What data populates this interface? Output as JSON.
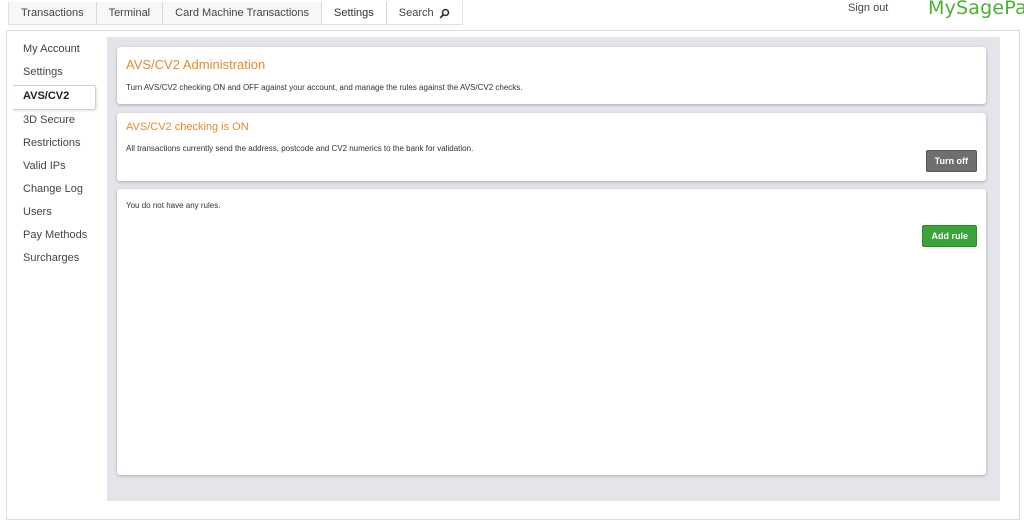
{
  "topnav": {
    "tabs": [
      {
        "label": "Transactions"
      },
      {
        "label": "Terminal"
      },
      {
        "label": "Card Machine Transactions"
      },
      {
        "label": "Settings",
        "active": true
      },
      {
        "label": "Search"
      }
    ]
  },
  "header": {
    "signout": "Sign out",
    "brand": "MySagePay"
  },
  "sidebar": {
    "items": [
      {
        "label": "My Account"
      },
      {
        "label": "Settings"
      },
      {
        "label": "AVS/CV2",
        "active": true
      },
      {
        "label": "3D Secure"
      },
      {
        "label": "Restrictions"
      },
      {
        "label": "Valid IPs"
      },
      {
        "label": "Change Log"
      },
      {
        "label": "Users"
      },
      {
        "label": "Pay Methods"
      },
      {
        "label": "Surcharges"
      }
    ]
  },
  "main": {
    "admin_panel": {
      "title": "AVS/CV2 Administration",
      "description": "Turn AVS/CV2 checking ON and OFF against your account, and manage the rules against the AVS/CV2 checks."
    },
    "status_panel": {
      "title": "AVS/CV2 checking is ON",
      "description": "All transactions currently send the address, postcode and CV2 numerics to the bank for validation.",
      "button": "Turn off"
    },
    "rules_panel": {
      "message": "You do not have any rules.",
      "button": "Add rule"
    }
  },
  "colors": {
    "accent_title": "#e58a2e",
    "brand": "#4bb133",
    "add_button": "#3aa33a",
    "turnoff_button": "#6f6f6f",
    "content_bg": "#e3e5ea"
  },
  "icons": {
    "search": "search-icon"
  }
}
